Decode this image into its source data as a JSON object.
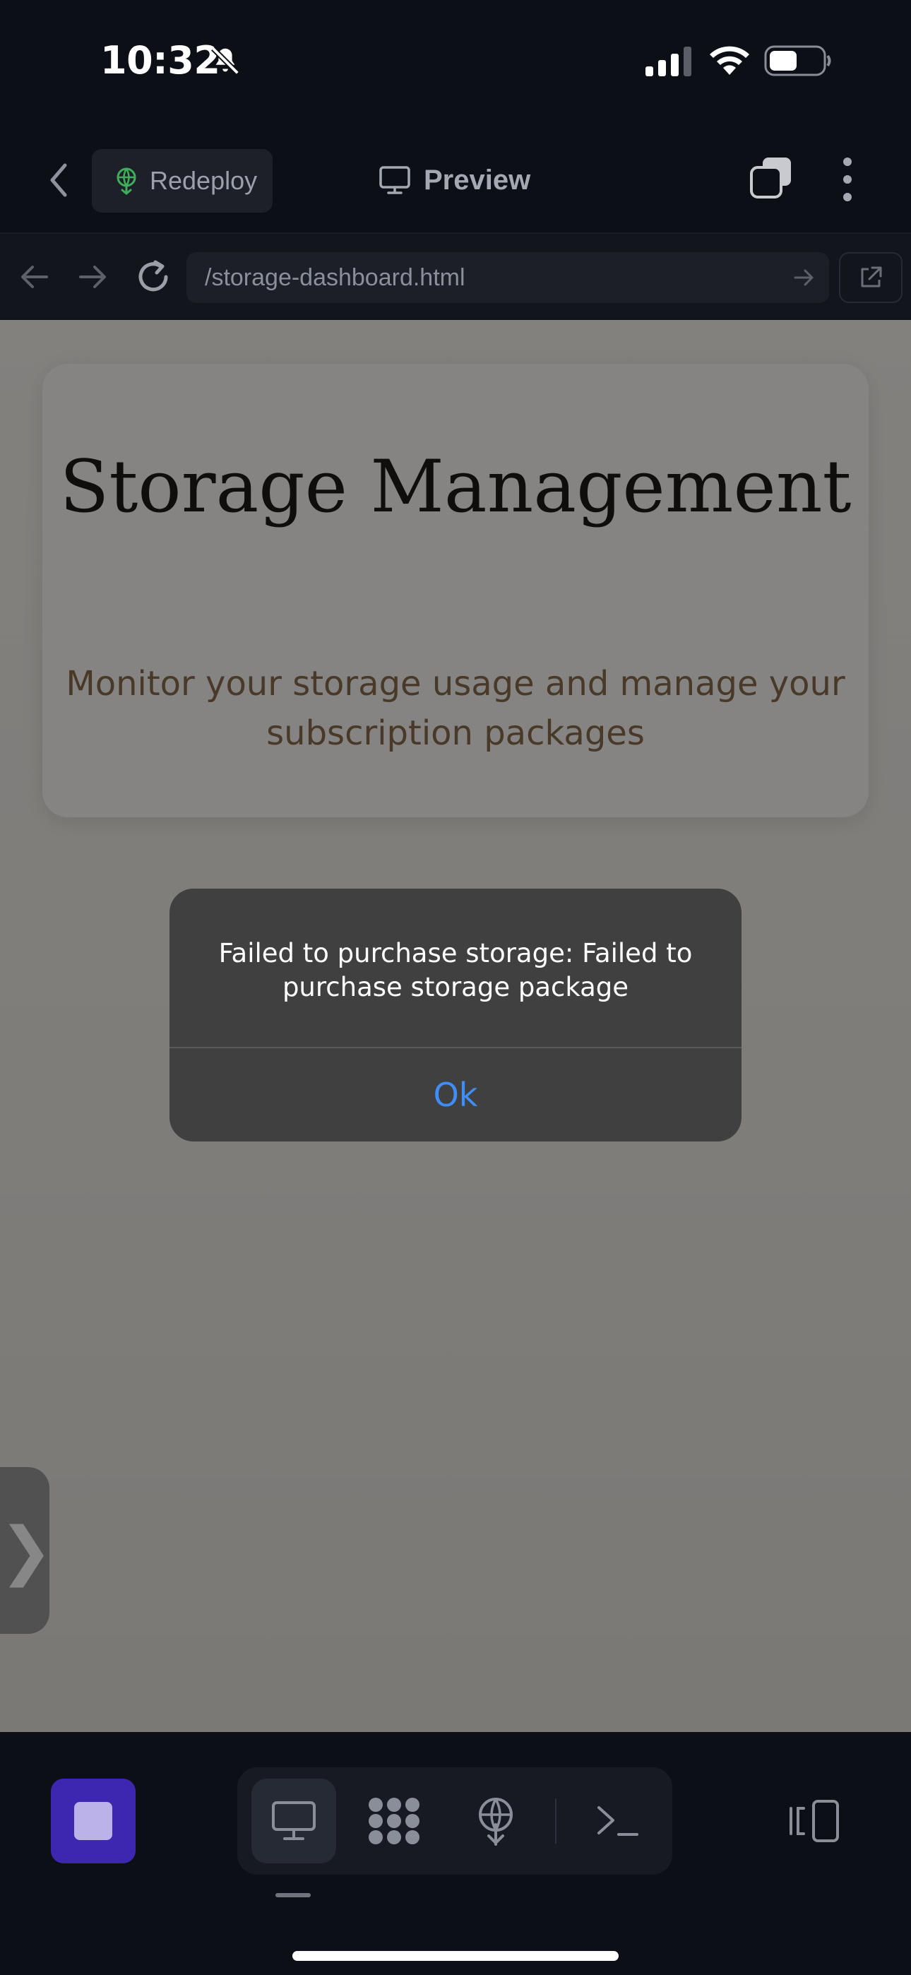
{
  "status_bar": {
    "time": "10:32"
  },
  "header": {
    "redeploy_label": "Redeploy",
    "preview_label": "Preview"
  },
  "url_bar": {
    "url": "/storage-dashboard.html"
  },
  "page": {
    "title": "Storage Management",
    "subtitle": "Monitor your storage usage and manage your subscription packages"
  },
  "alert": {
    "message": "Failed to purchase storage: Failed to purchase storage package",
    "ok_label": "Ok"
  },
  "colors": {
    "accent_stop": "#3e27b0",
    "link_blue": "#3f8ef7",
    "redeploy_icon": "#3fae5a",
    "subtitle_brown": "#8b6d4c"
  },
  "icons": {
    "toolbar": [
      "monitor-icon",
      "apps-grid-icon",
      "deploy-icon",
      "terminal-icon"
    ],
    "layout": "split-layout-icon"
  }
}
